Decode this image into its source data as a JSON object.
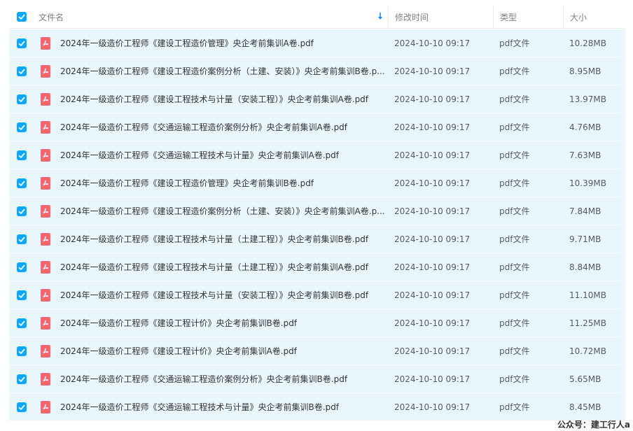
{
  "header": {
    "name_label": "文件名",
    "time_label": "修改时间",
    "type_label": "类型",
    "size_label": "大小"
  },
  "colors": {
    "accent": "#06a7ff",
    "row_selected_bg": "#eaf6fe",
    "pdf_icon": "#f5656e"
  },
  "files": [
    {
      "name": "2024年一级造价工程师《建设工程造价管理》央企考前集训A卷.pdf",
      "modified": "2024-10-10 09:17",
      "type": "pdf文件",
      "size": "10.28MB"
    },
    {
      "name": "2024年一级造价工程师《建设工程造价案例分析（土建、安装）》央企考前集训B卷.p...",
      "modified": "2024-10-10 09:17",
      "type": "pdf文件",
      "size": "8.95MB"
    },
    {
      "name": "2024年一级造价工程师《建设工程技术与计量（安装工程）》央企考前集训A卷.pdf",
      "modified": "2024-10-10 09:17",
      "type": "pdf文件",
      "size": "13.97MB"
    },
    {
      "name": "2024年一级造价工程师《交通运输工程造价案例分析》央企考前集训A卷.pdf",
      "modified": "2024-10-10 09:17",
      "type": "pdf文件",
      "size": "4.76MB"
    },
    {
      "name": "2024年一级造价工程师《交通运输工程技术与计量》央企考前集训A卷.pdf",
      "modified": "2024-10-10 09:17",
      "type": "pdf文件",
      "size": "7.63MB"
    },
    {
      "name": "2024年一级造价工程师《建设工程造价管理》央企考前集训B卷.pdf",
      "modified": "2024-10-10 09:17",
      "type": "pdf文件",
      "size": "10.39MB"
    },
    {
      "name": "2024年一级造价工程师《建设工程造价案例分析（土建、安装）》央企考前集训A卷.p...",
      "modified": "2024-10-10 09:17",
      "type": "pdf文件",
      "size": "7.84MB"
    },
    {
      "name": "2024年一级造价工程师《建设工程技术与计量（土建工程）》央企考前集训B卷.pdf",
      "modified": "2024-10-10 09:17",
      "type": "pdf文件",
      "size": "9.71MB"
    },
    {
      "name": "2024年一级造价工程师《建设工程技术与计量（土建工程）》央企考前集训A卷.pdf",
      "modified": "2024-10-10 09:17",
      "type": "pdf文件",
      "size": "8.84MB"
    },
    {
      "name": "2024年一级造价工程师《建设工程技术与计量（安装工程）》央企考前集训B卷.pdf",
      "modified": "2024-10-10 09:17",
      "type": "pdf文件",
      "size": "11.10MB"
    },
    {
      "name": "2024年一级造价工程师《建设工程计价》央企考前集训B卷.pdf",
      "modified": "2024-10-10 09:17",
      "type": "pdf文件",
      "size": "11.25MB"
    },
    {
      "name": "2024年一级造价工程师《建设工程计价》央企考前集训A卷.pdf",
      "modified": "2024-10-10 09:17",
      "type": "pdf文件",
      "size": "10.72MB"
    },
    {
      "name": "2024年一级造价工程师《交通运输工程造价案例分析》央企考前集训B卷.pdf",
      "modified": "2024-10-10 09:17",
      "type": "pdf文件",
      "size": "5.65MB"
    },
    {
      "name": "2024年一级造价工程师《交通运输工程技术与计量》央企考前集训B卷.pdf",
      "modified": "2024-10-10 09:17",
      "type": "pdf文件",
      "size": "8.45MB"
    }
  ],
  "watermark": "公众号：建工行人a"
}
